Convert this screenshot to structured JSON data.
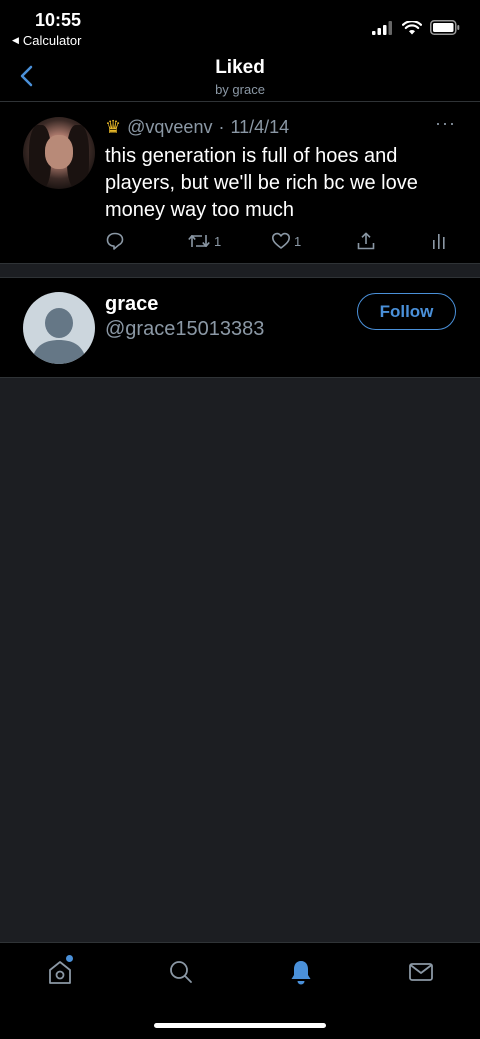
{
  "status_bar": {
    "time": "10:55",
    "back_app": "Calculator"
  },
  "header": {
    "title": "Liked",
    "subtitle": "by grace"
  },
  "tweet": {
    "handle": "@vqveenv",
    "separator": "·",
    "date": "11/4/14",
    "text": "this generation is full of hoes and players, but we'll be rich bc we love money way too much",
    "more": "···",
    "retweet_count": "1",
    "like_count": "1"
  },
  "user": {
    "name": "grace",
    "handle": "@grace15013383",
    "follow_label": "Follow"
  },
  "colors": {
    "accent": "#4a90d9",
    "secondary_text": "#8b98a5",
    "crown": "#e8b828"
  },
  "tabbar": {
    "items": [
      "home-icon",
      "search-icon",
      "notifications-bell-icon",
      "messages-envelope-icon"
    ]
  }
}
